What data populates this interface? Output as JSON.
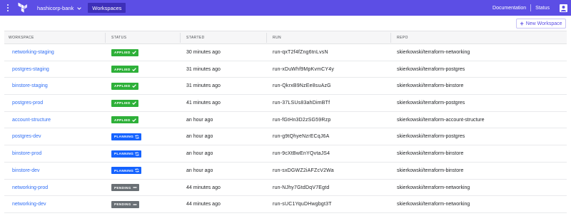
{
  "topbar": {
    "org_name": "hashicorp-bank",
    "active_tab": "Workspaces",
    "links": {
      "documentation": "Documentation",
      "status": "Status"
    }
  },
  "toolbar": {
    "new_workspace_label": "New Workspace"
  },
  "table": {
    "headers": {
      "workspace": "WORKSPACE",
      "status": "STATUS",
      "started": "STARTED",
      "run": "RUN",
      "repo": "REPO"
    },
    "rows": [
      {
        "workspace": "networking-staging",
        "status": "APPLIED",
        "started": "30 minutes ago",
        "run": "run-qxT2f4fZng6tnLvsN",
        "repo": "skierkowski/terraform-networking"
      },
      {
        "workspace": "postgres-staging",
        "status": "APPLIED",
        "started": "31 minutes ago",
        "run": "run-xDuWhf9MpKvmCY4y",
        "repo": "skierkowski/terraform-postgres"
      },
      {
        "workspace": "binstore-staging",
        "status": "APPLIED",
        "started": "31 minutes ago",
        "run": "run-QkrxB9NzEe8suAzG",
        "repo": "skierkowski/terraform-binstore"
      },
      {
        "workspace": "postgres-prod",
        "status": "APPLIED",
        "started": "41 minutes ago",
        "run": "run-37LSUs83ahDimBTf",
        "repo": "skierkowski/terraform-postgres"
      },
      {
        "workspace": "account-structure",
        "status": "APPLIED",
        "started": "an hour ago",
        "run": "run-fGtHn3D2zSG59Rzp",
        "repo": "skierkowski/terraform-account-structure"
      },
      {
        "workspace": "postgres-dev",
        "status": "PLANNING",
        "started": "an hour ago",
        "run": "run-g9tQhyeNzrECqJ6A",
        "repo": "skierkowski/terraform-postgres"
      },
      {
        "workspace": "binstore-prod",
        "status": "PLANNING",
        "started": "an hour ago",
        "run": "run-9cXtBwEnYQvtaJS4",
        "repo": "skierkowski/terraform-binstore"
      },
      {
        "workspace": "binstore-dev",
        "status": "PLANNING",
        "started": "an hour ago",
        "run": "run-sxDGWZ2iAFZcV2Wa",
        "repo": "skierkowski/terraform-binstore"
      },
      {
        "workspace": "networking-prod",
        "status": "PENDING",
        "started": "44 minutes ago",
        "run": "run-NJhy7GtdDqV7Egtd",
        "repo": "skierkowski/terraform-networking"
      },
      {
        "workspace": "networking-dev",
        "status": "PENDING",
        "started": "44 minutes ago",
        "run": "run-sUC1YquDHwgbgt3T",
        "repo": "skierkowski/terraform-networking"
      }
    ]
  },
  "status_styles": {
    "APPLIED": {
      "color": "#2eb039",
      "icon": "check-icon"
    },
    "PLANNING": {
      "color": "#1563ff",
      "icon": "sync-icon"
    },
    "PENDING": {
      "color": "#6a7075",
      "icon": "dash-icon"
    }
  },
  "colors": {
    "brand": "#5c4ee5",
    "link": "#2f6ef5"
  }
}
